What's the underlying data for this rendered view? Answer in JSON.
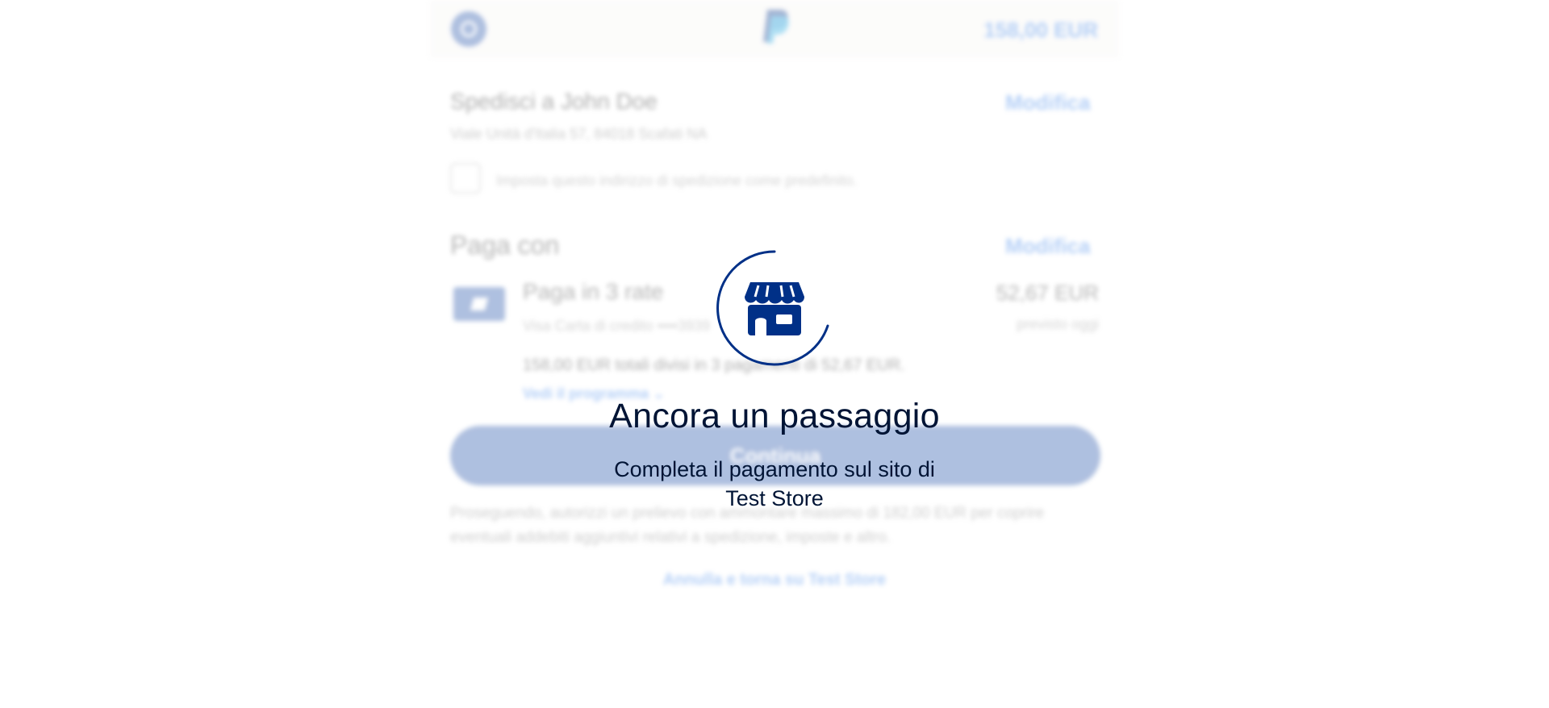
{
  "header": {
    "amount": "158,00 EUR"
  },
  "shipping": {
    "title": "Spedisci a John Doe",
    "edit_label": "Modifica",
    "address": "Viale Unità d'Italia 57, 84018 Scafati NA",
    "default_checkbox_label": "Imposta questo indirizzo di spedizione come predefinito."
  },
  "payment": {
    "title": "Paga con",
    "edit_label": "Modifica",
    "plan_name": "Paga in 3 rate",
    "plan_amount": "52,67 EUR",
    "card": "Visa Carta di credito ••••3939",
    "due": "previsto oggi",
    "total_note": "158,00 EUR totali divisi in 3 pagamenti di 52,67 EUR.",
    "view_schedule": "Vedi il programma"
  },
  "continue_button": {
    "label": "Continua"
  },
  "disclaimer": "Proseguendo, autorizzi un prelievo con ammontare massimo di 182,00 EUR per coprire eventuali addebiti aggiuntivi relativi a spedizione, imposte e altro.",
  "cancel_link": "Annulla e torna su Test Store",
  "overlay": {
    "title": "Ancora un passaggio",
    "subtitle": "Completa il pagamento sul sito di Test Store",
    "icon": "store-icon",
    "accent_color": "#003087"
  }
}
